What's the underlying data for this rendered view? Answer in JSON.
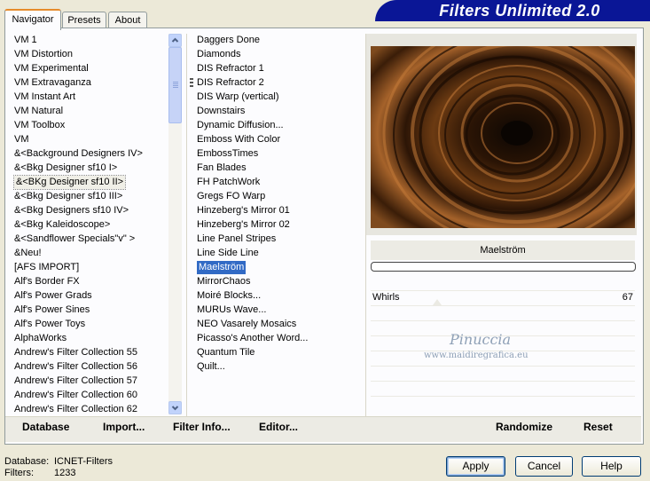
{
  "tabs": [
    "Navigator",
    "Presets",
    "About"
  ],
  "banner": {
    "title": "Filters Unlimited 2.0"
  },
  "categories": [
    "VM 1",
    "VM Distortion",
    "VM Experimental",
    "VM Extravaganza",
    "VM Instant Art",
    "VM Natural",
    "VM Toolbox",
    "VM",
    "&<Background Designers IV>",
    "&<Bkg Designer sf10 I>",
    "&<BKg Designer sf10 II>",
    "&<Bkg Designer sf10 III>",
    "&<Bkg Designers sf10 IV>",
    "&<Bkg Kaleidoscope>",
    "&<Sandflower Specials\"v\" >",
    "&Neu!",
    "[AFS IMPORT]",
    "Alf's Border FX",
    "Alf's Power Grads",
    "Alf's Power Sines",
    "Alf's Power Toys",
    "AlphaWorks",
    "Andrew's Filter Collection 55",
    "Andrew's Filter Collection 56",
    "Andrew's Filter Collection 57",
    "Andrew's Filter Collection 60",
    "Andrew's Filter Collection 62"
  ],
  "selected_category": "&<BKg Designer sf10 II>",
  "filters": [
    "Daggers Done",
    "Diamonds",
    "DIS Refractor 1",
    "DIS Refractor 2",
    "DIS Warp (vertical)",
    "Downstairs",
    "Dynamic Diffusion...",
    "Emboss With Color",
    "EmbossTimes",
    "Fan Blades",
    "FH PatchWork",
    "Gregs FO Warp",
    "Hinzeberg's Mirror 01",
    "Hinzeberg's Mirror 02",
    "Line Panel Stripes",
    "Line Side Line",
    "Maelström",
    "MirrorChaos",
    "Moiré Blocks...",
    "MURUs Wave...",
    "NEO Vasarely Mosaics",
    "Picasso's Another Word...",
    "Quantum Tile",
    "Quilt..."
  ],
  "selected_filter": "Maelström",
  "preview": {
    "filter_name": "Maelström"
  },
  "params": [
    {
      "label": "Whirls",
      "value": "67"
    }
  ],
  "watermark": {
    "name": "Pinuccia",
    "url": "www.maidiregrafica.eu"
  },
  "toolbar": {
    "database": "Database",
    "import": "Import...",
    "filter_info": "Filter Info...",
    "editor": "Editor...",
    "randomize": "Randomize",
    "reset": "Reset"
  },
  "footer": {
    "database_label": "Database:",
    "database_value": "ICNET-Filters",
    "filters_label": "Filters:",
    "filters_value": "1233"
  },
  "buttons": {
    "apply": "Apply",
    "cancel": "Cancel",
    "help": "Help"
  },
  "colors": {
    "banner": "#0a1696",
    "selection": "#316ac5",
    "tab_accent": "#e68b2c"
  }
}
